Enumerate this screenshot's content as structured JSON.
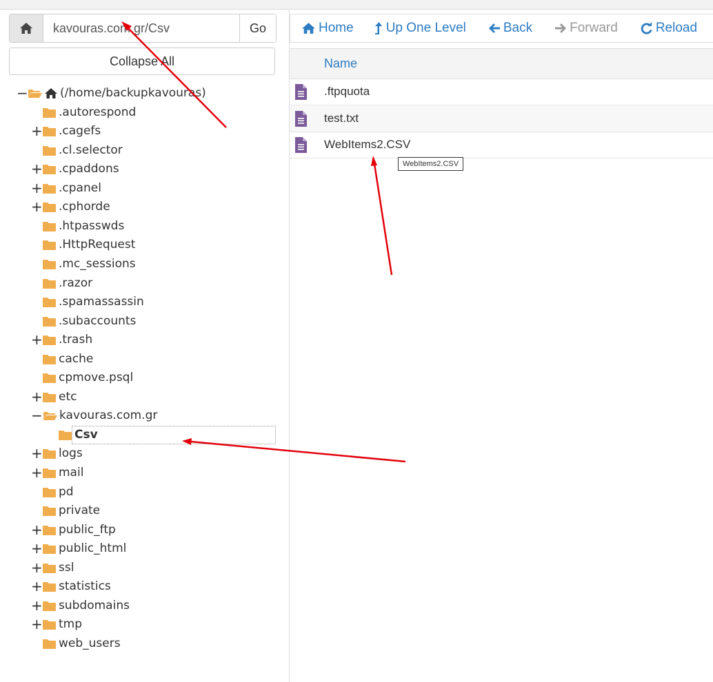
{
  "path_bar": {
    "value": "kavouras.com.gr/Csv",
    "go_label": "Go"
  },
  "collapse_all_label": "Collapse All",
  "tree": {
    "root_label": "(/home/backupkavouras)",
    "items": [
      {
        "label": ".autorespond",
        "toggle": ""
      },
      {
        "label": ".cagefs",
        "toggle": "+"
      },
      {
        "label": ".cl.selector",
        "toggle": ""
      },
      {
        "label": ".cpaddons",
        "toggle": "+"
      },
      {
        "label": ".cpanel",
        "toggle": "+"
      },
      {
        "label": ".cphorde",
        "toggle": "+"
      },
      {
        "label": ".htpasswds",
        "toggle": ""
      },
      {
        "label": ".HttpRequest",
        "toggle": ""
      },
      {
        "label": ".mc_sessions",
        "toggle": ""
      },
      {
        "label": ".razor",
        "toggle": ""
      },
      {
        "label": ".spamassassin",
        "toggle": ""
      },
      {
        "label": ".subaccounts",
        "toggle": ""
      },
      {
        "label": ".trash",
        "toggle": "+"
      },
      {
        "label": "cache",
        "toggle": ""
      },
      {
        "label": "cpmove.psql",
        "toggle": ""
      },
      {
        "label": "etc",
        "toggle": "+"
      },
      {
        "label": "kavouras.com.gr",
        "toggle": "−"
      },
      {
        "label": "Csv",
        "toggle": ""
      },
      {
        "label": "logs",
        "toggle": "+"
      },
      {
        "label": "mail",
        "toggle": "+"
      },
      {
        "label": "pd",
        "toggle": ""
      },
      {
        "label": "private",
        "toggle": ""
      },
      {
        "label": "public_ftp",
        "toggle": "+"
      },
      {
        "label": "public_html",
        "toggle": "+"
      },
      {
        "label": "ssl",
        "toggle": "+"
      },
      {
        "label": "statistics",
        "toggle": "+"
      },
      {
        "label": "subdomains",
        "toggle": "+"
      },
      {
        "label": "tmp",
        "toggle": "+"
      },
      {
        "label": "web_users",
        "toggle": ""
      }
    ]
  },
  "toolbar": {
    "home": "Home",
    "up_one_level": "Up One Level",
    "back": "Back",
    "forward": "Forward",
    "reload": "Reload"
  },
  "file_list": {
    "column_name": "Name",
    "files": [
      ".ftpquota",
      "test.txt",
      "WebItems2.CSV"
    ]
  },
  "tooltip_text": "WebItems2.CSV",
  "colors": {
    "link_blue": "#2d7cc2",
    "folder_orange": "#f0ad4e",
    "file_purple": "#7a5a98",
    "annotation_red": "#e3000b"
  }
}
